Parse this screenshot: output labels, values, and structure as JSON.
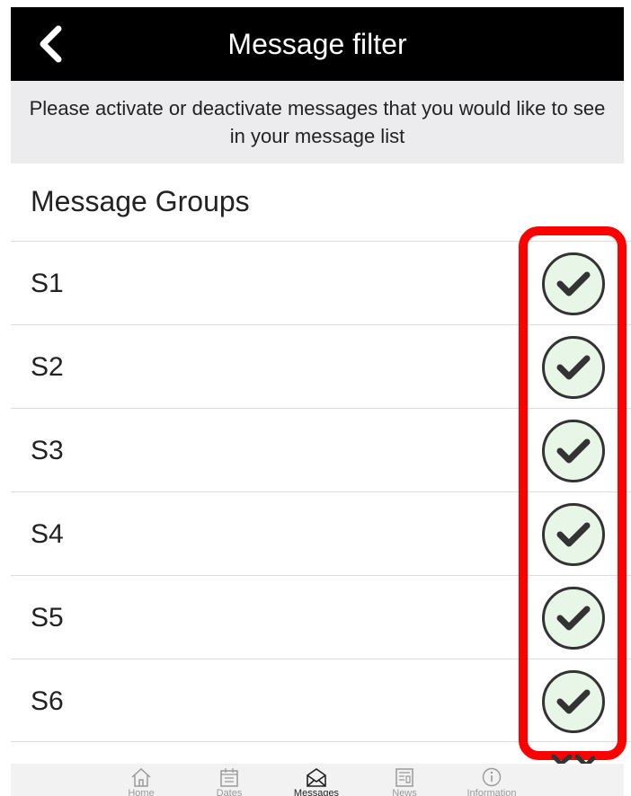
{
  "header": {
    "title": "Message filter",
    "back_icon": "chevron-left-icon"
  },
  "instructions": "Please activate or deactivate messages that you would like to see in your message list",
  "section_title": "Message Groups",
  "groups": [
    {
      "label": "S1",
      "checked": true
    },
    {
      "label": "S2",
      "checked": true
    },
    {
      "label": "S3",
      "checked": true
    },
    {
      "label": "S4",
      "checked": true
    },
    {
      "label": "S5",
      "checked": true
    },
    {
      "label": "S6",
      "checked": true
    }
  ],
  "tabs": [
    {
      "label": "Home",
      "icon": "home-icon"
    },
    {
      "label": "Dates",
      "icon": "calendar-icon"
    },
    {
      "label": "Messages",
      "icon": "envelope-icon",
      "active": true
    },
    {
      "label": "News",
      "icon": "newspaper-icon"
    },
    {
      "label": "Information",
      "icon": "info-icon"
    }
  ],
  "colors": {
    "header_bg": "#000000",
    "highlight": "#ff0000",
    "check_fill": "#e8f6e8"
  }
}
